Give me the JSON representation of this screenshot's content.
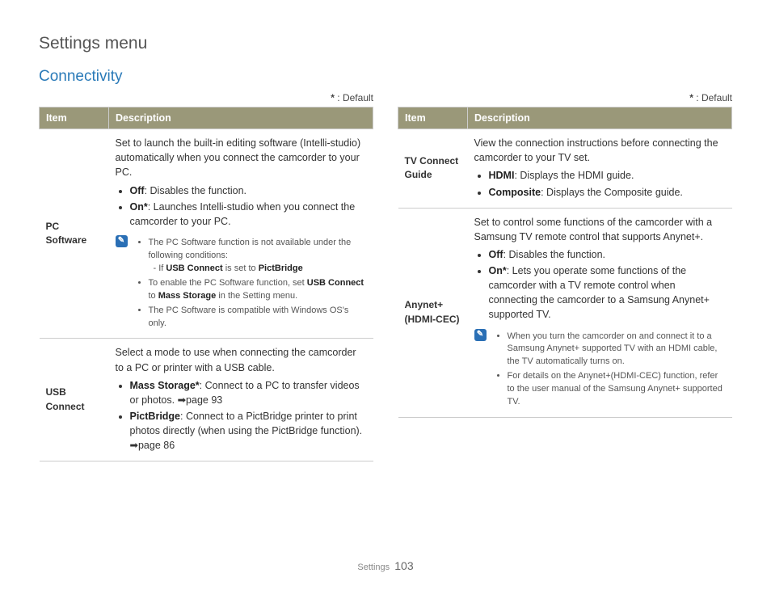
{
  "pageTitle": "Settings menu",
  "sectionTitle": "Connectivity",
  "defaultLegend": {
    "star": "*",
    "text": " : Default"
  },
  "headers": {
    "item": "Item",
    "desc": "Description"
  },
  "left": {
    "pcSoftware": {
      "item": "PC Software",
      "intro": "Set to launch the built-in editing software (Intelli-studio) automatically when you connect the camcorder to your PC.",
      "b1": {
        "label": "Off",
        "text": ": Disables the function."
      },
      "b2": {
        "label": "On*",
        "text": ": Launches Intelli-studio when you connect the camcorder to your PC."
      },
      "note": {
        "n1": "The PC Software function is not available under the following conditions:",
        "n1sub_prefix": "- If ",
        "n1sub_b1": "USB Connect",
        "n1sub_mid": " is set to ",
        "n1sub_b2": "PictBridge",
        "n2_prefix": "To enable the PC Software function, set ",
        "n2_b1": "USB Connect",
        "n2_mid": " to ",
        "n2_b2": "Mass Storage",
        "n2_suffix": " in the Setting menu.",
        "n3": "The PC Software is compatible with Windows OS's only."
      }
    },
    "usbConnect": {
      "item": "USB Connect",
      "intro": "Select a mode to use when connecting the camcorder to a PC or printer with a USB cable.",
      "b1": {
        "label": "Mass Storage*",
        "text": ": Connect to a PC to transfer videos or photos. ",
        "ref": "➡page 93"
      },
      "b2": {
        "label": "PictBridge",
        "text": ": Connect to a PictBridge printer to print photos directly (when using the PictBridge function). ",
        "ref": "➡page 86"
      }
    }
  },
  "right": {
    "tvConnect": {
      "item": "TV Connect Guide",
      "intro": "View the connection instructions before connecting the camcorder to your TV set.",
      "b1": {
        "label": "HDMI",
        "text": ": Displays the HDMI guide."
      },
      "b2": {
        "label": "Composite",
        "text": ": Displays the Composite guide."
      }
    },
    "anynet": {
      "item": "Anynet+ (HDMI-CEC)",
      "intro": "Set to control some functions of the camcorder with a Samsung TV remote control that supports Anynet+.",
      "b1": {
        "label": "Off",
        "text": ": Disables the function."
      },
      "b2": {
        "label": "On*",
        "text": ": Lets you operate some functions of the camcorder with a TV remote control when connecting the camcorder to a Samsung Anynet+ supported TV."
      },
      "note": {
        "n1": "When you turn the camcorder on and connect it to a Samsung Anynet+ supported TV with an HDMI cable, the TV automatically turns on.",
        "n2": "For details on the Anynet+(HDMI-CEC) function, refer to the user manual of the Samsung Anynet+ supported TV."
      }
    }
  },
  "footer": {
    "label": "Settings",
    "page": "103"
  }
}
